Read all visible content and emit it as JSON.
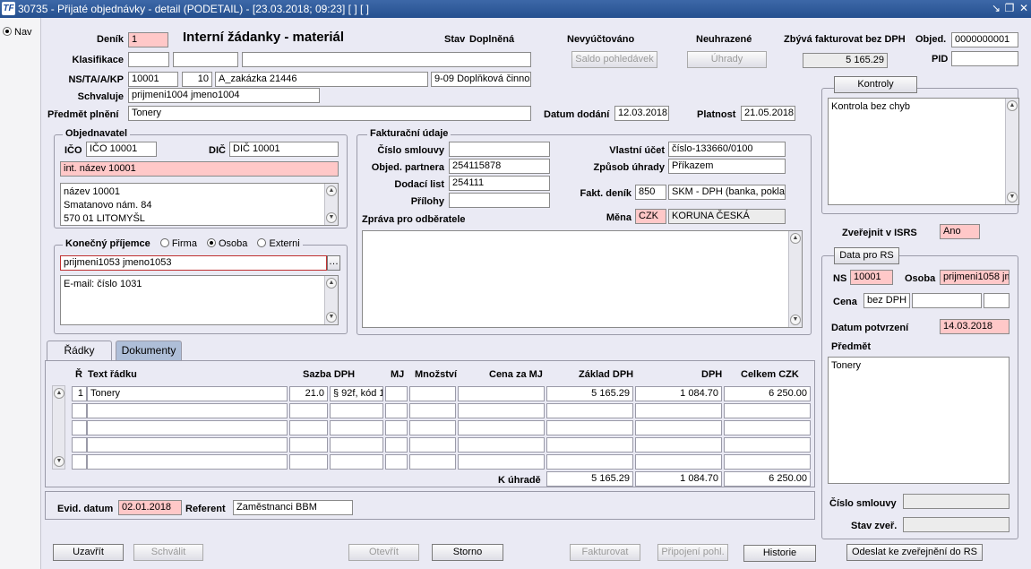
{
  "window": {
    "title": "30735 - Přijaté objednávky - detail (PODETAIL) - [23.03.2018; 09:23] [ ] [ ]",
    "app_icon": "TF"
  },
  "nav": {
    "label": "Nav"
  },
  "header": {
    "denik_label": "Deník",
    "denik": "1",
    "doc_title": "Interní žádanky - materiál",
    "stav_label": "Stav",
    "stav": "Doplněná",
    "nevyuctovano": "Nevyúčtováno",
    "neuhrazene": "Neuhrazené",
    "zbyva_label": "Zbývá fakturovat bez DPH",
    "zbyva": "5 165.29",
    "objed_label": "Objed.",
    "objed": "0000000001",
    "pid_label": "PID",
    "pid": "",
    "saldo_btn": "Saldo pohledávek",
    "uhrady_btn": "Úhrady",
    "klasifikace_label": "Klasifikace",
    "ns_label": "NS/TA/A/KP",
    "ns": "10001",
    "ta": "10",
    "a": "A_zakázka 21446",
    "kp": "9-09 Doplňková činnos",
    "schvaluje_label": "Schvaluje",
    "schvaluje": "prijmeni1004 jmeno1004",
    "predmet_label": "Předmět plnění",
    "predmet": "Tonery",
    "datum_dodani_label": "Datum dodání",
    "datum_dodani": "12.03.2018",
    "platnost_label": "Platnost",
    "platnost": "21.05.2018"
  },
  "objednavatel": {
    "title": "Objednavatel",
    "ico_label": "IČO",
    "ico": "IČO 10001",
    "dic_label": "DIČ",
    "dic": "DIČ 10001",
    "int_nazev": "int. název 10001",
    "address": [
      "název 10001",
      "Smatanovo nám. 84",
      "570 01  LITOMYŠL"
    ]
  },
  "prijemce": {
    "title": "Konečný příjemce",
    "firma": "Firma",
    "osoba": "Osoba",
    "externi": "Externi",
    "name": "prijmeni1053 jmeno1053",
    "note": "E-mail: číslo 1031"
  },
  "faktura": {
    "title": "Fakturační údaje",
    "cislo_smlouvy_label": "Číslo smlouvy",
    "cislo_smlouvy": "",
    "objed_partnera_label": "Objed. partnera",
    "objed_partnera": "254115878",
    "dodaci_list_label": "Dodací list",
    "dodaci_list": "254111",
    "prilohy_label": "Přílohy",
    "prilohy": "",
    "zprava_label": "Zpráva pro odběratele",
    "vlastni_ucet_label": "Vlastní účet",
    "vlastni_ucet": "číslo-133660/0100",
    "zpusob_uhrady_label": "Způsob úhrady",
    "zpusob_uhrady": "Příkazem",
    "fakt_denik_label": "Fakt. deník",
    "fakt_denik": "850",
    "fakt_denik_name": "SKM - DPH  (banka, poklad",
    "mena_label": "Měna",
    "mena": "CZK",
    "mena_name": "KORUNA ČESKÁ"
  },
  "kontroly": {
    "btn": "Kontroly",
    "text": "Kontrola bez chyb"
  },
  "isrs": {
    "label": "Zveřejnit v ISRS",
    "value": "Ano"
  },
  "rs": {
    "btn": "Data pro RS",
    "ns_label": "NS",
    "ns": "10001",
    "osoba_label": "Osoba",
    "osoba": "prijmeni1058 jm",
    "cena_label": "Cena",
    "cena": "bez DPH",
    "datum_label": "Datum potvrzení",
    "datum": "14.03.2018",
    "predmet_label": "Předmět",
    "predmet": "Tonery",
    "cislo_smlouvy_label": "Číslo smlouvy",
    "cislo_smlouvy": "",
    "stav_label": "Stav zveř.",
    "stav": ""
  },
  "tabs": {
    "radky": "Řádky",
    "dokumenty": "Dokumenty"
  },
  "grid": {
    "headers": {
      "r": "Ř",
      "text": "Text řádku",
      "sazba": "Sazba DPH",
      "mj": "MJ",
      "mnozstvi": "Množství",
      "cena_mj": "Cena za MJ",
      "zaklad": "Základ DPH",
      "dph": "DPH",
      "celkem": "Celkem  CZK"
    },
    "rows": [
      {
        "r": "1",
        "text": "Tonery",
        "sazba": "21.0",
        "kod": "§ 92f, kód 1",
        "mj": "",
        "mnozstvi": "",
        "cena": "",
        "zaklad": "5 165.29",
        "dph": "1 084.70",
        "celkem": "6 250.00"
      }
    ],
    "total_label": "K úhradě",
    "total_zaklad": "5 165.29",
    "total_dph": "1 084.70",
    "total_celkem": "6 250.00"
  },
  "footer": {
    "evid_label": "Evid. datum",
    "evid": "02.01.2018",
    "referent_label": "Referent",
    "referent": "Zaměstnanci BBM"
  },
  "buttons": {
    "uzavrit": "Uzavřít",
    "schvalit": "Schválit",
    "otevrit": "Otevřít",
    "storno": "Storno",
    "fakturovat": "Fakturovat",
    "pripojeni": "Připojení pohl.",
    "historie": "Historie",
    "odeslat": "Odeslat ke zveřejnění do RS"
  }
}
